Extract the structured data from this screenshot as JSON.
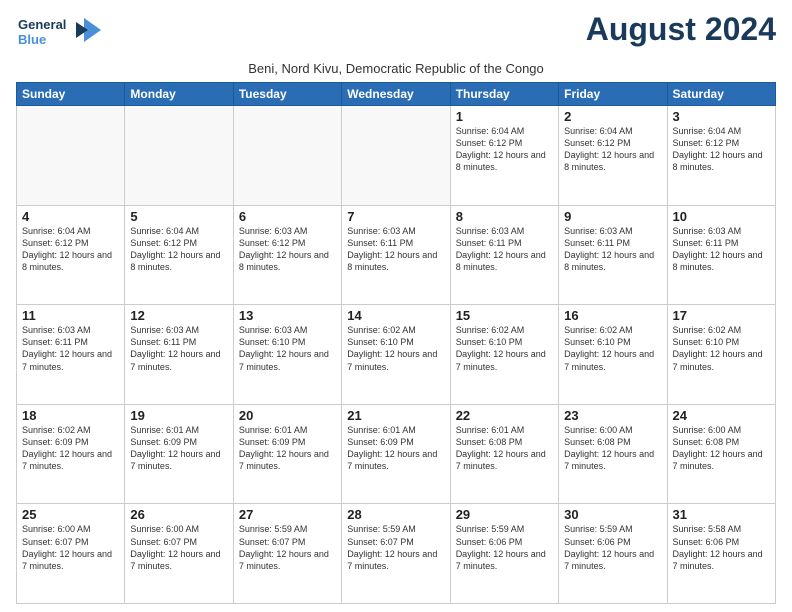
{
  "logo": {
    "line1": "General",
    "line2": "Blue"
  },
  "title": "August 2024",
  "location": "Beni, Nord Kivu, Democratic Republic of the Congo",
  "days_header": [
    "Sunday",
    "Monday",
    "Tuesday",
    "Wednesday",
    "Thursday",
    "Friday",
    "Saturday"
  ],
  "weeks": [
    [
      {
        "num": "",
        "info": "",
        "empty": true
      },
      {
        "num": "",
        "info": "",
        "empty": true
      },
      {
        "num": "",
        "info": "",
        "empty": true
      },
      {
        "num": "",
        "info": "",
        "empty": true
      },
      {
        "num": "1",
        "info": "Sunrise: 6:04 AM\nSunset: 6:12 PM\nDaylight: 12 hours\nand 8 minutes.",
        "empty": false
      },
      {
        "num": "2",
        "info": "Sunrise: 6:04 AM\nSunset: 6:12 PM\nDaylight: 12 hours\nand 8 minutes.",
        "empty": false
      },
      {
        "num": "3",
        "info": "Sunrise: 6:04 AM\nSunset: 6:12 PM\nDaylight: 12 hours\nand 8 minutes.",
        "empty": false
      }
    ],
    [
      {
        "num": "4",
        "info": "Sunrise: 6:04 AM\nSunset: 6:12 PM\nDaylight: 12 hours\nand 8 minutes.",
        "empty": false
      },
      {
        "num": "5",
        "info": "Sunrise: 6:04 AM\nSunset: 6:12 PM\nDaylight: 12 hours\nand 8 minutes.",
        "empty": false
      },
      {
        "num": "6",
        "info": "Sunrise: 6:03 AM\nSunset: 6:12 PM\nDaylight: 12 hours\nand 8 minutes.",
        "empty": false
      },
      {
        "num": "7",
        "info": "Sunrise: 6:03 AM\nSunset: 6:11 PM\nDaylight: 12 hours\nand 8 minutes.",
        "empty": false
      },
      {
        "num": "8",
        "info": "Sunrise: 6:03 AM\nSunset: 6:11 PM\nDaylight: 12 hours\nand 8 minutes.",
        "empty": false
      },
      {
        "num": "9",
        "info": "Sunrise: 6:03 AM\nSunset: 6:11 PM\nDaylight: 12 hours\nand 8 minutes.",
        "empty": false
      },
      {
        "num": "10",
        "info": "Sunrise: 6:03 AM\nSunset: 6:11 PM\nDaylight: 12 hours\nand 8 minutes.",
        "empty": false
      }
    ],
    [
      {
        "num": "11",
        "info": "Sunrise: 6:03 AM\nSunset: 6:11 PM\nDaylight: 12 hours\nand 7 minutes.",
        "empty": false
      },
      {
        "num": "12",
        "info": "Sunrise: 6:03 AM\nSunset: 6:11 PM\nDaylight: 12 hours\nand 7 minutes.",
        "empty": false
      },
      {
        "num": "13",
        "info": "Sunrise: 6:03 AM\nSunset: 6:10 PM\nDaylight: 12 hours\nand 7 minutes.",
        "empty": false
      },
      {
        "num": "14",
        "info": "Sunrise: 6:02 AM\nSunset: 6:10 PM\nDaylight: 12 hours\nand 7 minutes.",
        "empty": false
      },
      {
        "num": "15",
        "info": "Sunrise: 6:02 AM\nSunset: 6:10 PM\nDaylight: 12 hours\nand 7 minutes.",
        "empty": false
      },
      {
        "num": "16",
        "info": "Sunrise: 6:02 AM\nSunset: 6:10 PM\nDaylight: 12 hours\nand 7 minutes.",
        "empty": false
      },
      {
        "num": "17",
        "info": "Sunrise: 6:02 AM\nSunset: 6:10 PM\nDaylight: 12 hours\nand 7 minutes.",
        "empty": false
      }
    ],
    [
      {
        "num": "18",
        "info": "Sunrise: 6:02 AM\nSunset: 6:09 PM\nDaylight: 12 hours\nand 7 minutes.",
        "empty": false
      },
      {
        "num": "19",
        "info": "Sunrise: 6:01 AM\nSunset: 6:09 PM\nDaylight: 12 hours\nand 7 minutes.",
        "empty": false
      },
      {
        "num": "20",
        "info": "Sunrise: 6:01 AM\nSunset: 6:09 PM\nDaylight: 12 hours\nand 7 minutes.",
        "empty": false
      },
      {
        "num": "21",
        "info": "Sunrise: 6:01 AM\nSunset: 6:09 PM\nDaylight: 12 hours\nand 7 minutes.",
        "empty": false
      },
      {
        "num": "22",
        "info": "Sunrise: 6:01 AM\nSunset: 6:08 PM\nDaylight: 12 hours\nand 7 minutes.",
        "empty": false
      },
      {
        "num": "23",
        "info": "Sunrise: 6:00 AM\nSunset: 6:08 PM\nDaylight: 12 hours\nand 7 minutes.",
        "empty": false
      },
      {
        "num": "24",
        "info": "Sunrise: 6:00 AM\nSunset: 6:08 PM\nDaylight: 12 hours\nand 7 minutes.",
        "empty": false
      }
    ],
    [
      {
        "num": "25",
        "info": "Sunrise: 6:00 AM\nSunset: 6:07 PM\nDaylight: 12 hours\nand 7 minutes.",
        "empty": false
      },
      {
        "num": "26",
        "info": "Sunrise: 6:00 AM\nSunset: 6:07 PM\nDaylight: 12 hours\nand 7 minutes.",
        "empty": false
      },
      {
        "num": "27",
        "info": "Sunrise: 5:59 AM\nSunset: 6:07 PM\nDaylight: 12 hours\nand 7 minutes.",
        "empty": false
      },
      {
        "num": "28",
        "info": "Sunrise: 5:59 AM\nSunset: 6:07 PM\nDaylight: 12 hours\nand 7 minutes.",
        "empty": false
      },
      {
        "num": "29",
        "info": "Sunrise: 5:59 AM\nSunset: 6:06 PM\nDaylight: 12 hours\nand 7 minutes.",
        "empty": false
      },
      {
        "num": "30",
        "info": "Sunrise: 5:59 AM\nSunset: 6:06 PM\nDaylight: 12 hours\nand 7 minutes.",
        "empty": false
      },
      {
        "num": "31",
        "info": "Sunrise: 5:58 AM\nSunset: 6:06 PM\nDaylight: 12 hours\nand 7 minutes.",
        "empty": false
      }
    ]
  ]
}
